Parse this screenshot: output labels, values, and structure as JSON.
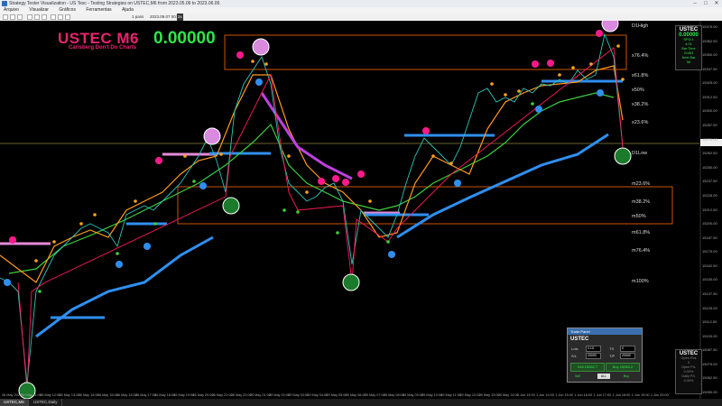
{
  "window": {
    "title": "Strategy Tester Visualization - US Tesc - Testing Strategies on USTEC,M6 from 2023.05.06 to 2023.06.06"
  },
  "menu": [
    "Arquivo",
    "Visualizar",
    "Gráficos",
    "Ferramentas",
    "Ajuda"
  ],
  "toolbar": {
    "speed_label": "1 pass",
    "date_label": "2023.09.07 00:00",
    "zoom_label": "2x"
  },
  "chart": {
    "symbol_title": "USTEC M6",
    "subtitle": "Carlsberg Don't Do Charts",
    "value": "0.00000",
    "fib_levels": [
      "D1High",
      "x76.4%",
      "x61.8%",
      "x50%",
      "x38.2%",
      "x23.6%",
      "D1Low",
      "m23.6%",
      "m38.2%",
      "m50%",
      "m61.8%",
      "m76.4%",
      "m100%"
    ],
    "price_labels": [
      "15375.00",
      "15362.50",
      "15350.00",
      "15337.50",
      "15325.00",
      "15312.50",
      "15300.00",
      "15287.50",
      "15275.00",
      "15262.50",
      "15250.00",
      "15237.50",
      "15225.00",
      "15212.50",
      "15200.00",
      "15187.50",
      "15175.00",
      "15162.50",
      "15150.00",
      "15137.50",
      "15125.00",
      "15112.50",
      "15100.00",
      "15087.50",
      "15075.00",
      "15062.50",
      "15050.00"
    ],
    "time_labels": [
      "26 May 2023",
      "26 May 11:00",
      "26 May 12:00",
      "26 May 13:00",
      "26 May 14:00",
      "26 May 15:00",
      "26 May 16:00",
      "26 May 17:00",
      "26 May 18:00",
      "26 May 19:00",
      "26 May 20:00",
      "26 May 21:00",
      "26 May 22:00",
      "29 May 01:00",
      "29 May 02:00",
      "29 May 03:00",
      "29 May 04:00",
      "29 May 05:00",
      "29 May 06:00",
      "29 May 07:00",
      "29 May 08:00",
      "29 May 09:00",
      "29 May 10:00",
      "29 May 11:00",
      "29 May 12:00",
      "29 May 13:00",
      "29 May 14:00",
      "1 Jun 13:00",
      "1 Jun 14:00",
      "1 Jun 15:00",
      "1 Jun 16:00",
      "1 Jun 17:00",
      "1 Jun 18:00",
      "1 Jun 19:00",
      "1 Jun 20:00"
    ]
  },
  "info_panel": {
    "name": "USTEC",
    "price": "0.00000",
    "spread": "SPD:1",
    "time": "4:01",
    "bar": "Bar Time",
    "count": "21453",
    "nxt": "Next Bar",
    "nxt_val": "56"
  },
  "status_panel": {
    "name": "USTEC",
    "l1": "Open Pos",
    "l2": "0",
    "l3": "Open P/L",
    "l4": "0.00%",
    "l5": "Daily P/L",
    "l6": "0.00%"
  },
  "trade_panel": {
    "header": "Trade Panel",
    "symbol": "USTEC",
    "lots_label": "Lots",
    "lots": "0.10",
    "sl_label": "S/L",
    "sl": "20000",
    "tp_label": "T/P",
    "tp": "20000",
    "ts_label": "TS",
    "ts": "0",
    "sell_label": "Sell 15062.7",
    "buy_label": "Buy 15063.2",
    "sell_small": "Sell",
    "close": "ALL",
    "buy_small": "Buy"
  },
  "tabs": [
    "USTEC,M6",
    "USTEC,Daily"
  ],
  "colors": {
    "accent_pink": "#e8246e",
    "green": "#2ee54a",
    "orange": "#ff8c1a",
    "blue": "#2f8ff0",
    "magenta": "#c040e0"
  }
}
